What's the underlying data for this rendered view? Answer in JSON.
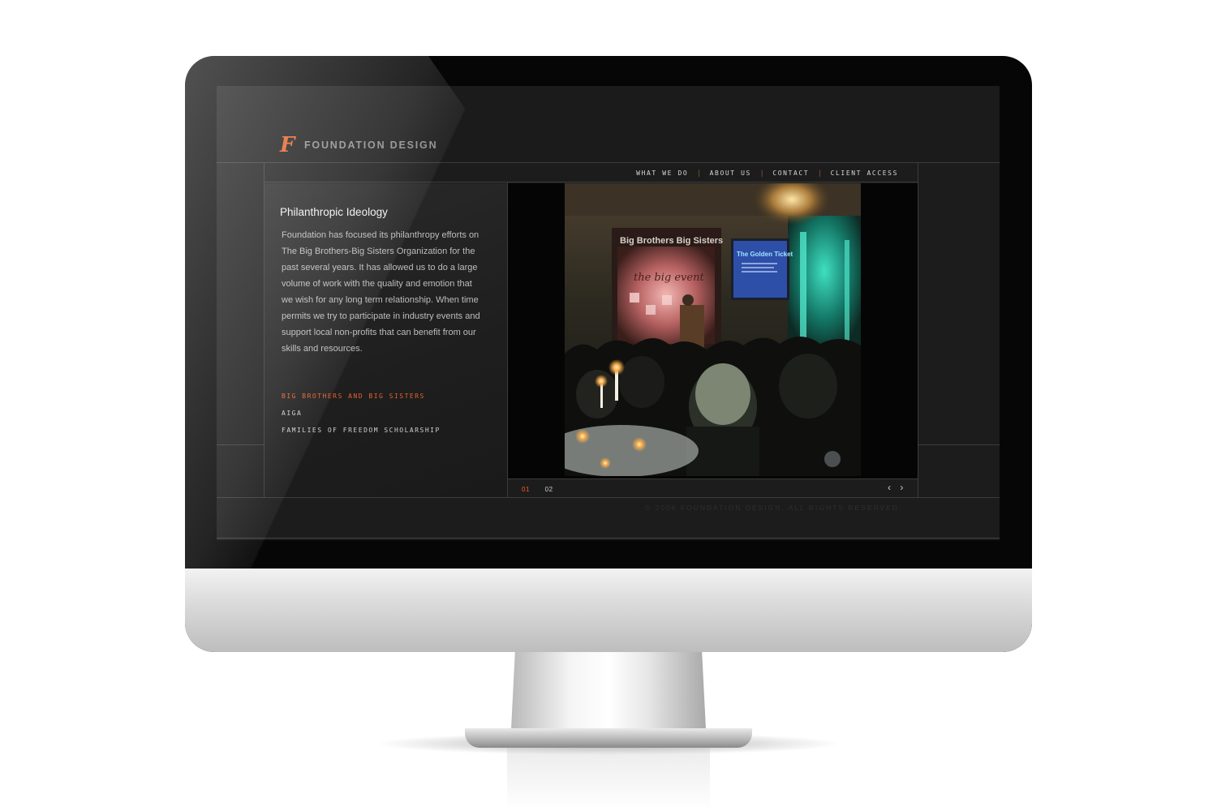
{
  "site": {
    "logo_text": "FOUNDATION DESIGN",
    "logo_mark": "F",
    "nav": [
      {
        "label": "WHAT WE DO"
      },
      {
        "label": "ABOUT US"
      },
      {
        "label": "CONTACT"
      },
      {
        "label": "CLIENT ACCESS"
      }
    ],
    "nav_separator": "|",
    "heading": "Philanthropic Ideology",
    "body": "Foundation has focused its philanthropy efforts on The Big Brothers-Big Sisters Organization for the past several years. It has allowed us to do a large volume of work with the quality and emotion that we wish for any long term relationship. When time permits we try to participate in industry events and support local non-profits that can benefit from our skills and resources.",
    "links": [
      {
        "label": "BIG BROTHERS AND BIG SISTERS",
        "active": true
      },
      {
        "label": "AIGA",
        "active": false
      },
      {
        "label": "FAMILIES OF FREEDOM SCHOLARSHIP",
        "active": false
      }
    ],
    "photo": {
      "stage_banner_1": "Big Brothers Big Sisters",
      "stage_banner_2": "the big event",
      "screen_title": "The Golden Ticket"
    },
    "pager": [
      {
        "label": "01",
        "active": true
      },
      {
        "label": "02",
        "active": false
      }
    ],
    "prev_arrow": "‹",
    "next_arrow": "›",
    "copyright": "© 2006 FOUNDATION DESIGN. ALL RIGHTS RESERVED."
  },
  "colors": {
    "accent": "#e8622b",
    "background": "#1c1c1c",
    "text": "#bdbdbd"
  }
}
